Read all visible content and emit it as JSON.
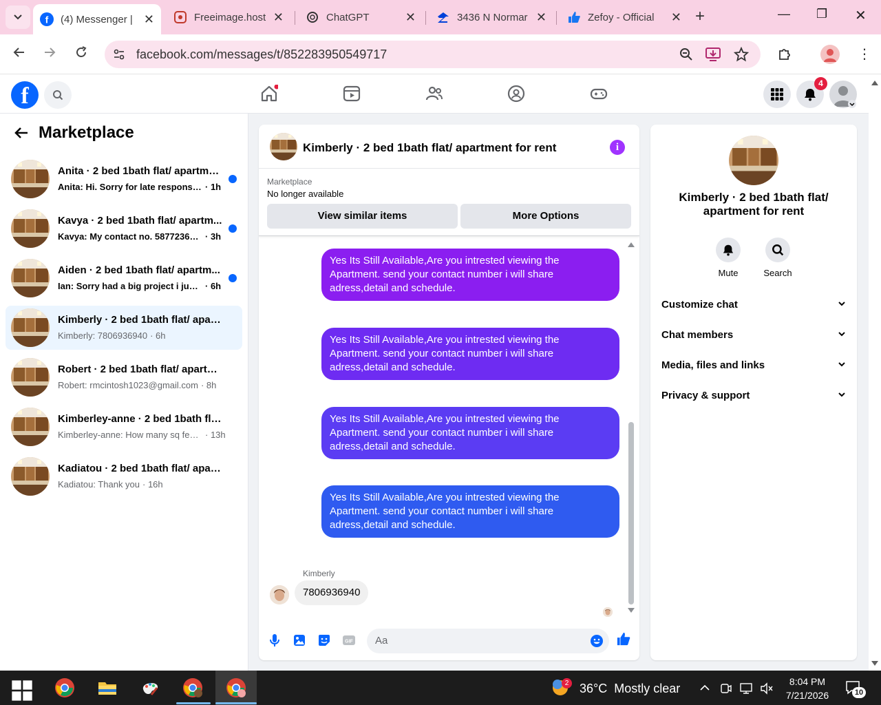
{
  "browser": {
    "tabs": [
      {
        "title": "(4) Messenger |",
        "active": true
      },
      {
        "title": "Freeimage.host",
        "active": false
      },
      {
        "title": "ChatGPT",
        "active": false
      },
      {
        "title": "3436 N Normar",
        "active": false
      },
      {
        "title": "Zefoy - Official",
        "active": false
      }
    ],
    "url": "facebook.com/messages/t/852283950549717"
  },
  "facebook": {
    "notification_count": "4"
  },
  "sidebar": {
    "title": "Marketplace",
    "conversations": [
      {
        "name": "Anita · 2 bed 1bath flat/ apartme...",
        "preview": "Anita: Hi. Sorry for late response, ...",
        "time": "· 1h",
        "unread": true
      },
      {
        "name": "Kavya · 2 bed 1bath flat/ apartm...",
        "preview": "Kavya: My contact no. 5877236370",
        "time": "· 3h",
        "unread": true
      },
      {
        "name": "Aiden · 2 bed 1bath flat/ apartm...",
        "preview": "Ian: Sorry had a big project i just fi...",
        "time": "· 6h",
        "unread": true
      },
      {
        "name": "Kimberly · 2 bed 1bath flat/ apart...",
        "preview": "Kimberly: 7806936940",
        "time": "· 6h",
        "unread": false
      },
      {
        "name": "Robert · 2 bed 1bath flat/ apartme...",
        "preview": "Robert: rmcintosh1023@gmail.com",
        "time": "· 8h",
        "unread": false
      },
      {
        "name": "Kimberley-anne · 2 bed 1bath flat/...",
        "preview": "Kimberley-anne: How many sq feet ...",
        "time": "· 13h",
        "unread": false
      },
      {
        "name": "Kadiatou · 2 bed 1bath flat/ apart...",
        "preview": "Kadiatou: Thank you",
        "time": "· 16h",
        "unread": false
      }
    ]
  },
  "chat": {
    "title": "Kimberly · 2 bed 1bath flat/ apartment for rent",
    "marketplace_label": "Marketplace",
    "listing_status": "No longer available",
    "view_similar_label": "View similar items",
    "more_options_label": "More Options",
    "outgoing_messages": [
      "Yes Its Still Available,Are you intrested viewing the Apartment. send your contact number i will share adress,detail and schedule.",
      "Yes Its Still Available,Are you intrested viewing the Apartment. send your contact number i will share adress,detail and schedule.",
      "Yes Its Still Available,Are you intrested viewing the Apartment. send your contact number i will share adress,detail and schedule.",
      "Yes Its Still Available,Are you intrested viewing the Apartment. send your contact number i will share adress,detail and schedule."
    ],
    "bubble_colors": [
      "#8b1ef0",
      "#6e2cf2",
      "#5b3cf3",
      "#2f5bf0"
    ],
    "incoming_sender": "Kimberly",
    "incoming_message": "7806936940",
    "composer_placeholder": "Aa"
  },
  "details_panel": {
    "title": "Kimberly · 2 bed 1bath flat/ apartment for rent",
    "actions": [
      {
        "label": "Mute",
        "icon": "bell-icon"
      },
      {
        "label": "Search",
        "icon": "search-icon"
      }
    ],
    "sections": [
      "Customize chat",
      "Chat members",
      "Media, files and links",
      "Privacy & support"
    ]
  },
  "taskbar": {
    "weather_badge": "2",
    "weather": "36°C  Mostly clear",
    "time": "8:04 PM",
    "date": "7/21/2026",
    "notification_count": "10"
  },
  "colors": {
    "facebook_blue": "#0866ff",
    "accent_purple": "#a033ff",
    "tabbar_pink": "#f9d2e4"
  }
}
